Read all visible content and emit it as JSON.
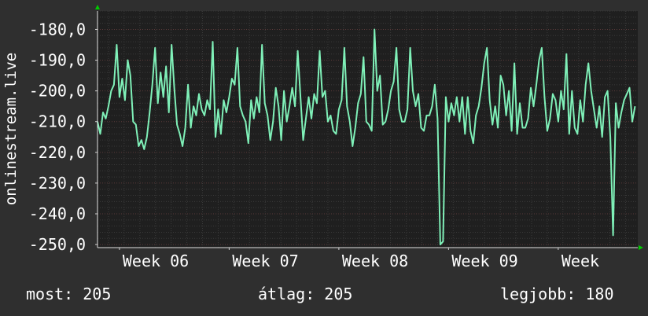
{
  "chart_data": {
    "type": "line",
    "ylabel": "onlinestream.live",
    "ylim": [
      -251,
      -174
    ],
    "yticks": [
      -180,
      -190,
      -200,
      -210,
      -220,
      -230,
      -240,
      -250
    ],
    "ytick_labels": [
      "-180,0",
      "-190,0",
      "-200,0",
      "-210,0",
      "-220,0",
      "-230,0",
      "-240,0",
      "-250,0"
    ],
    "x_range": [
      0,
      98.5
    ],
    "xtick_labels": [
      {
        "x": 4,
        "label": "Week 06"
      },
      {
        "x": 24,
        "label": "Week 07"
      },
      {
        "x": 44,
        "label": "Week 08"
      },
      {
        "x": 64,
        "label": "Week 09"
      },
      {
        "x": 84,
        "label": "Week"
      }
    ],
    "grid": true,
    "colors": {
      "background": "#2f2f2f",
      "plot_bg": "#1f1f1f",
      "grid": "#4a4a4a",
      "line": "#7ff0b8",
      "axis_arrow": "#00cc00"
    },
    "series": [
      {
        "values": [
          [
            0,
            -210
          ],
          [
            0.5,
            -214
          ],
          [
            1,
            -207
          ],
          [
            1.5,
            -209
          ],
          [
            2,
            -205
          ],
          [
            2.5,
            -200
          ],
          [
            3,
            -198
          ],
          [
            3.5,
            -185
          ],
          [
            4,
            -202
          ],
          [
            4.5,
            -196
          ],
          [
            5,
            -203
          ],
          [
            5.5,
            -190
          ],
          [
            6,
            -195
          ],
          [
            6.5,
            -210
          ],
          [
            7,
            -211
          ],
          [
            7.5,
            -218
          ],
          [
            8,
            -216
          ],
          [
            8.5,
            -219
          ],
          [
            9,
            -215
          ],
          [
            9.5,
            -207
          ],
          [
            10,
            -198
          ],
          [
            10.5,
            -186
          ],
          [
            11,
            -204
          ],
          [
            11.5,
            -194
          ],
          [
            12,
            -202
          ],
          [
            12.5,
            -192
          ],
          [
            13,
            -207
          ],
          [
            13.5,
            -185
          ],
          [
            14,
            -199
          ],
          [
            14.5,
            -211
          ],
          [
            15,
            -214
          ],
          [
            15.5,
            -218
          ],
          [
            16,
            -212
          ],
          [
            16.5,
            -198
          ],
          [
            17,
            -212
          ],
          [
            17.5,
            -205
          ],
          [
            18,
            -208
          ],
          [
            18.5,
            -201
          ],
          [
            19,
            -206
          ],
          [
            19.5,
            -208
          ],
          [
            20,
            -203
          ],
          [
            20.5,
            -206
          ],
          [
            21,
            -184
          ],
          [
            21.5,
            -215
          ],
          [
            22,
            -206
          ],
          [
            22.5,
            -214
          ],
          [
            23,
            -203
          ],
          [
            23.5,
            -207
          ],
          [
            24,
            -202
          ],
          [
            24.5,
            -196
          ],
          [
            25,
            -198
          ],
          [
            25.5,
            -186
          ],
          [
            26,
            -205
          ],
          [
            26.5,
            -208
          ],
          [
            27,
            -210
          ],
          [
            27.5,
            -217
          ],
          [
            28,
            -203
          ],
          [
            28.5,
            -209
          ],
          [
            29,
            -202
          ],
          [
            29.5,
            -207
          ],
          [
            30,
            -185
          ],
          [
            30.5,
            -204
          ],
          [
            31,
            -208
          ],
          [
            31.5,
            -216
          ],
          [
            32,
            -210
          ],
          [
            32.5,
            -199
          ],
          [
            33,
            -205
          ],
          [
            33.5,
            -216
          ],
          [
            34,
            -200
          ],
          [
            34.5,
            -210
          ],
          [
            35,
            -205
          ],
          [
            35.5,
            -199
          ],
          [
            36,
            -205
          ],
          [
            36.5,
            -187
          ],
          [
            37,
            -202
          ],
          [
            37.5,
            -216
          ],
          [
            38,
            -209
          ],
          [
            38.5,
            -202
          ],
          [
            39,
            -209
          ],
          [
            39.5,
            -201
          ],
          [
            40,
            -204
          ],
          [
            40.5,
            -187
          ],
          [
            41,
            -202
          ],
          [
            41.5,
            -200
          ],
          [
            42,
            -210
          ],
          [
            42.5,
            -208
          ],
          [
            43,
            -213
          ],
          [
            43.5,
            -214
          ],
          [
            44,
            -206
          ],
          [
            44.5,
            -203
          ],
          [
            45,
            -186
          ],
          [
            45.5,
            -205
          ],
          [
            46,
            -210
          ],
          [
            46.5,
            -218
          ],
          [
            47,
            -212
          ],
          [
            47.5,
            -204
          ],
          [
            48,
            -201
          ],
          [
            48.5,
            -189
          ],
          [
            49,
            -210
          ],
          [
            49.5,
            -211
          ],
          [
            50,
            -213
          ],
          [
            50.5,
            -180
          ],
          [
            51,
            -200
          ],
          [
            51.5,
            -195
          ],
          [
            52,
            -211
          ],
          [
            52.5,
            -210
          ],
          [
            53,
            -206
          ],
          [
            53.5,
            -200
          ],
          [
            54,
            -197
          ],
          [
            54.5,
            -186
          ],
          [
            55,
            -206
          ],
          [
            55.5,
            -210
          ],
          [
            56,
            -210
          ],
          [
            56.5,
            -206
          ],
          [
            57,
            -186
          ],
          [
            57.5,
            -200
          ],
          [
            58,
            -205
          ],
          [
            58.5,
            -201
          ],
          [
            59,
            -212
          ],
          [
            59.5,
            -213
          ],
          [
            60,
            -208
          ],
          [
            60.5,
            -208
          ],
          [
            61,
            -205
          ],
          [
            61.5,
            -198
          ],
          [
            62,
            -209
          ],
          [
            62.5,
            -250
          ],
          [
            63,
            -249
          ],
          [
            63.5,
            -202
          ],
          [
            64,
            -210
          ],
          [
            64.5,
            -204
          ],
          [
            65,
            -208
          ],
          [
            65.5,
            -202
          ],
          [
            66,
            -210
          ],
          [
            66.5,
            -202
          ],
          [
            67,
            -214
          ],
          [
            67.5,
            -202
          ],
          [
            68,
            -213
          ],
          [
            68.5,
            -217
          ],
          [
            69,
            -208
          ],
          [
            69.5,
            -205
          ],
          [
            70,
            -199
          ],
          [
            70.5,
            -191
          ],
          [
            71,
            -186
          ],
          [
            71.5,
            -203
          ],
          [
            72,
            -211
          ],
          [
            72.5,
            -205
          ],
          [
            73,
            -212
          ],
          [
            73.5,
            -195
          ],
          [
            74,
            -198
          ],
          [
            74.5,
            -208
          ],
          [
            75,
            -200
          ],
          [
            75.5,
            -213
          ],
          [
            76,
            -191
          ],
          [
            76.5,
            -214
          ],
          [
            77,
            -204
          ],
          [
            77.5,
            -212
          ],
          [
            78,
            -212
          ],
          [
            78.5,
            -209
          ],
          [
            79,
            -199
          ],
          [
            79.5,
            -205
          ],
          [
            80,
            -198
          ],
          [
            80.5,
            -190
          ],
          [
            81,
            -186
          ],
          [
            81.5,
            -202
          ],
          [
            82,
            -213
          ],
          [
            82.5,
            -209
          ],
          [
            83,
            -201
          ],
          [
            83.5,
            -203
          ],
          [
            84,
            -210
          ],
          [
            84.5,
            -200
          ],
          [
            85,
            -206
          ],
          [
            85.5,
            -188
          ],
          [
            86,
            -214
          ],
          [
            86.5,
            -200
          ],
          [
            87,
            -212
          ],
          [
            87.5,
            -214
          ],
          [
            88,
            -203
          ],
          [
            88.5,
            -210
          ],
          [
            89,
            -198
          ],
          [
            89.5,
            -191
          ],
          [
            90,
            -200
          ],
          [
            90.5,
            -206
          ],
          [
            91,
            -212
          ],
          [
            91.5,
            -205
          ],
          [
            92,
            -215
          ],
          [
            92.5,
            -202
          ],
          [
            93,
            -200
          ],
          [
            93.5,
            -215
          ],
          [
            94,
            -247
          ],
          [
            94.5,
            -204
          ],
          [
            95,
            -212
          ],
          [
            95.5,
            -207
          ],
          [
            96,
            -203
          ],
          [
            96.5,
            -201
          ],
          [
            97,
            -199
          ],
          [
            97.5,
            -210
          ],
          [
            98,
            -205
          ]
        ]
      }
    ]
  },
  "stats": {
    "now_label": "most:",
    "now_value": "205",
    "avg_label": "átlag:",
    "avg_value": "205",
    "best_label": "legjobb:",
    "best_value": "180"
  }
}
